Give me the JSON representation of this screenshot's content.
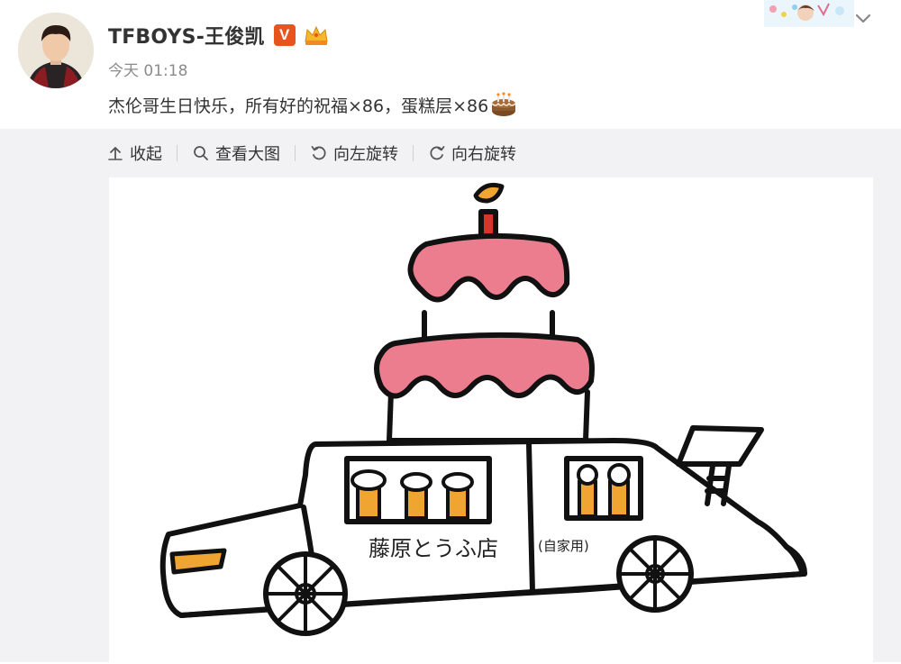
{
  "post": {
    "username": "TFBOYS-王俊凯",
    "vip_badge": "V",
    "timestamp": "今天 01:18",
    "text": "杰伦哥生日快乐，所有好的祝福×86，蛋糕层×86"
  },
  "toolbar": {
    "collapse_label": "收起",
    "view_large_label": "查看大图",
    "rotate_left_label": "向左旋转",
    "rotate_right_label": "向右旋转"
  },
  "drawing": {
    "shop_sign_text": "藤原とうふ店",
    "private_label": "(自家用)"
  },
  "icons": [
    "avatar-photo",
    "vip-v-icon",
    "crown-icon",
    "cake-emoji-icon",
    "card-decoration",
    "chevron-down-icon",
    "arrow-up-icon",
    "magnifier-icon",
    "rotate-left-icon",
    "rotate-right-icon"
  ],
  "colors": {
    "vip_badge": "#e8541e",
    "cake_pink": "#ec7d8f",
    "flame_orange": "#f0a431",
    "candle_red": "#d9342b",
    "media_bg": "#f2f2f5"
  }
}
